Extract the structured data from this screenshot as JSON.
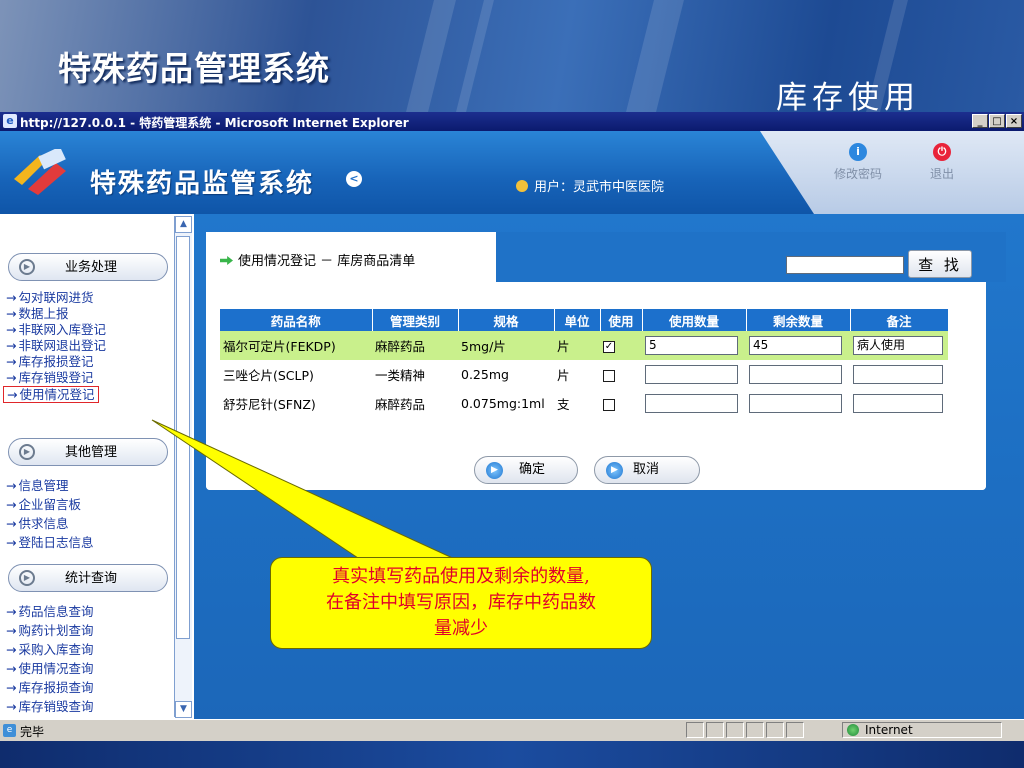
{
  "slide": {
    "title": "特殊药品管理系统",
    "subtitle": "库存使用"
  },
  "browser": {
    "title": "http://127.0.0.1 - 特药管理系统 - Microsoft Internet Explorer",
    "min": "_",
    "max": "□",
    "close": "×",
    "status_text": "完毕",
    "zone_text": "Internet"
  },
  "header": {
    "app_name": "特殊药品监管系统",
    "user_label": "用户：",
    "user_name": "灵武市中医医院",
    "change_password": "修改密码",
    "logout": "退出"
  },
  "sidebar": {
    "sections": [
      {
        "label": "业务处理",
        "items": [
          "勾对联网进货",
          "数据上报",
          "非联网入库登记",
          "非联网退出登记",
          "库存报损登记",
          "库存销毁登记",
          "使用情况登记"
        ]
      },
      {
        "label": "其他管理",
        "items": [
          "信息管理",
          "企业留言板",
          "供求信息",
          "登陆日志信息"
        ]
      },
      {
        "label": "统计查询",
        "items": [
          "药品信息查询",
          "购药计划查询",
          "采购入库查询",
          "使用情况查询",
          "库存报损查询",
          "库存销毁查询"
        ]
      }
    ],
    "selected": "使用情况登记"
  },
  "main": {
    "title": "使用情况登记 － 库房商品清单",
    "search_value": "",
    "search_button": "查 找",
    "columns": [
      "药品名称",
      "管理类别",
      "规格",
      "单位",
      "使用",
      "使用数量",
      "剩余数量",
      "备注"
    ],
    "rows": [
      {
        "name": "福尔可定片(FEKDP)",
        "category": "麻醉药品",
        "spec": "5mg/片",
        "unit": "片",
        "checked": "✓",
        "use_qty": "5",
        "remain_qty": "45",
        "note": "病人使用"
      },
      {
        "name": "三唑仑片(SCLP)",
        "category": "一类精神",
        "spec": "0.25mg",
        "unit": "片",
        "checked": "",
        "use_qty": "",
        "remain_qty": "",
        "note": ""
      },
      {
        "name": "舒芬尼针(SFNZ)",
        "category": "麻醉药品",
        "spec": "0.075mg:1ml",
        "unit": "支",
        "checked": "",
        "use_qty": "",
        "remain_qty": "",
        "note": ""
      }
    ],
    "confirm": "确定",
    "cancel": "取消"
  },
  "callout": {
    "line1": "真实填写药品使用及剩余的数量,",
    "line2": "在备注中填写原因，库存中药品数",
    "line3": "量减少"
  },
  "colors": {
    "header_blue": "#1763b8",
    "table_header": "#1c70cc",
    "row_highlight": "#c9f08c",
    "callout_bg": "#ffff00",
    "callout_text": "#e0002a"
  }
}
